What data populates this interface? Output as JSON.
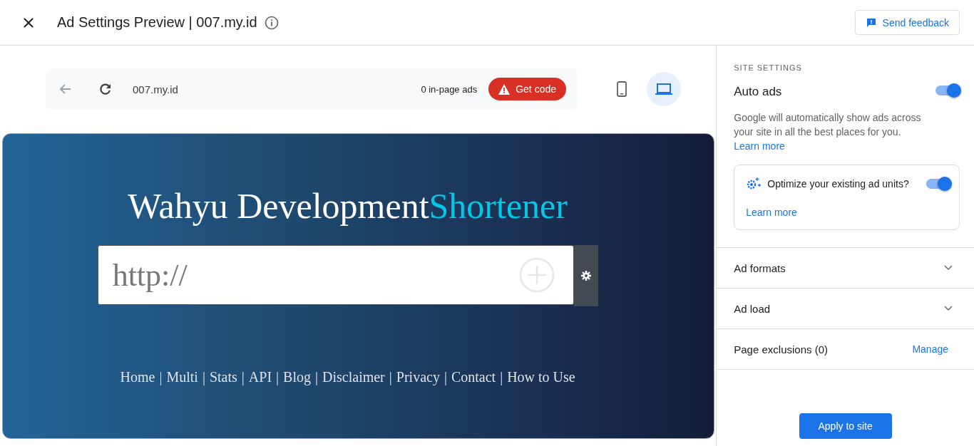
{
  "header": {
    "title": "Ad Settings Preview | 007.my.id",
    "feedback_button": "Send feedback"
  },
  "preview_bar": {
    "url": "007.my.id",
    "ads_count": "0 in-page ads",
    "get_code_button": "Get code"
  },
  "devices": [
    {
      "kind": "phone",
      "selected": false
    },
    {
      "kind": "laptop",
      "selected": true
    }
  ],
  "site": {
    "title": "Wahyu Development",
    "title_accent": "Shortener",
    "url_placeholder": "http://",
    "separator": "|",
    "nav_links": [
      "Home",
      "Multi",
      "Stats",
      "API",
      "Blog",
      "Disclaimer",
      "Privacy",
      "Contact",
      "How to Use"
    ]
  },
  "panel": {
    "section_label": "SITE SETTINGS",
    "auto_ads": {
      "label": "Auto ads",
      "on": true
    },
    "description": "Google will automatically show ads across your site in all the best places for you.",
    "learn_more": "Learn more",
    "optimize": {
      "label": "Optimize your existing ad units?",
      "on": true,
      "learn_more": "Learn more"
    },
    "sections": [
      {
        "label": "Ad formats",
        "kind": "expand"
      },
      {
        "label": "Ad load",
        "kind": "expand"
      },
      {
        "label": "Page exclusions (0)",
        "kind": "action",
        "action": "Manage"
      }
    ],
    "apply_button": "Apply to site"
  }
}
